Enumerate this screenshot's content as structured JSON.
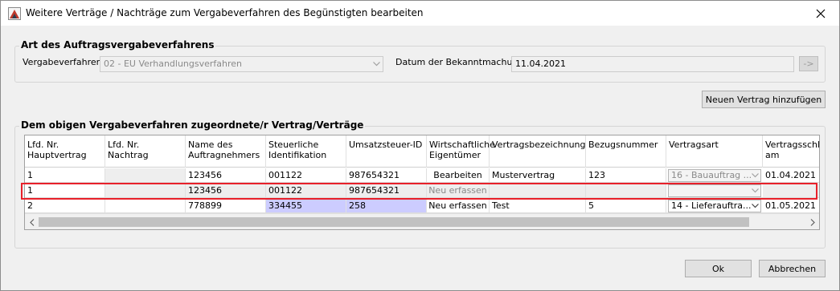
{
  "window": {
    "title": "Weitere Verträge / Nachträge zum Vergabeverfahren des Begünstigten bearbeiten",
    "close_glyph": "✕"
  },
  "group1": {
    "legend": "Art des Auftragsvergabeverfahrens",
    "vergabe_label": "Vergabeverfahren",
    "vergabe_value": "02 - EU Verhandlungsverfahren",
    "datum_label": "Datum der Bekanntmachung",
    "datum_value": "11.04.2021",
    "goto_label": "->"
  },
  "add_contract_label": "Neuen Vertrag hinzufügen",
  "group2": {
    "legend": "Dem obigen Vergabeverfahren zugeordnete/r Vertrag/Verträge",
    "columns": [
      "Lfd. Nr. Hauptvertrag",
      "Lfd. Nr. Nachtrag",
      "Name des Auftragnehmers",
      "Steuerliche Identifikation",
      "Umsatzsteuer-ID",
      "Wirtschaftliche Eigentümer",
      "Vertragsbezeichnung",
      "Bezugsnummer",
      "Vertragsart",
      "Vertragsschluss am"
    ],
    "rows": [
      {
        "hauptvertrag": "1",
        "nachtrag": "",
        "name": "123456",
        "steuer_id": "001122",
        "ust_id": "987654321",
        "eigentuemer": "Bearbeiten",
        "bezeichnung": "Mustervertrag",
        "bezugsnummer": "123",
        "vertragsart": "16 - Bauauftrag ...",
        "schluss": "01.04.2021"
      },
      {
        "hauptvertrag": "1",
        "nachtrag": "",
        "name": "123456",
        "steuer_id": "001122",
        "ust_id": "987654321",
        "eigentuemer": "Neu erfassen",
        "bezeichnung": "",
        "bezugsnummer": "",
        "vertragsart": "",
        "schluss": ""
      },
      {
        "hauptvertrag": "2",
        "nachtrag": "",
        "name": "778899",
        "steuer_id": "334455",
        "ust_id": "258",
        "eigentuemer": "Neu erfassen",
        "bezeichnung": "Test",
        "bezugsnummer": "5",
        "vertragsart": "14 - Lieferauftra...",
        "schluss": "01.05.2021"
      }
    ]
  },
  "ok_label": "Ok",
  "cancel_label": "Abbrechen",
  "colors": {
    "highlight": "#e8202a",
    "selected_cell": "#ccccff"
  }
}
